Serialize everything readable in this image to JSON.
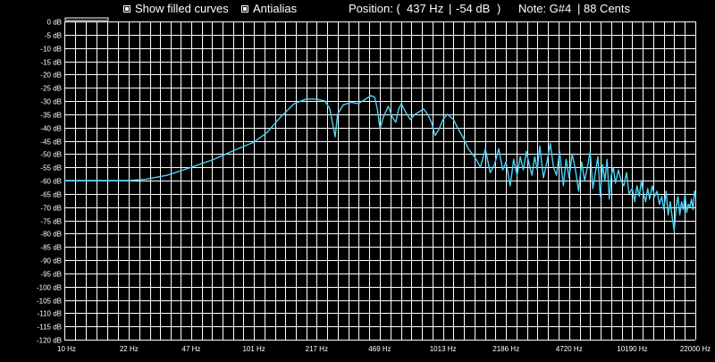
{
  "toolbar": {
    "show_filled_curves": {
      "label": "Show filled curves",
      "checked": true
    },
    "antialias": {
      "label": "Antialias",
      "checked": true
    },
    "position_label": "Position: (",
    "position_freq": "437 Hz",
    "position_sep": "|",
    "position_db": "-54 dB",
    "position_close": ")",
    "note_label": "Note: G#4",
    "cents_label": "| 88 Cents"
  },
  "colors": {
    "curve": "#4fd2f5",
    "grid": "#ffffff",
    "background": "#000000"
  },
  "chart_data": {
    "type": "line",
    "title": "",
    "xlabel": "",
    "ylabel": "",
    "x_scale": "log",
    "xlim": [
      10,
      22000
    ],
    "ylim": [
      -120,
      0
    ],
    "x_ticks": [
      10,
      22,
      47,
      101,
      217,
      469,
      1013,
      2186,
      4720,
      10190,
      22000
    ],
    "x_tick_labels": [
      "10 Hz",
      "22 Hz",
      "47 Hz",
      "101 Hz",
      "217 Hz",
      "469 Hz",
      "1013 Hz",
      "2186 Hz",
      "4720 Hz",
      "10190 Hz",
      "22000 Hz"
    ],
    "y_ticks": [
      0,
      -5,
      -10,
      -15,
      -20,
      -25,
      -30,
      -35,
      -40,
      -45,
      -50,
      -55,
      -60,
      -65,
      -70,
      -75,
      -80,
      -85,
      -90,
      -95,
      -100,
      -105,
      -110,
      -115,
      -120
    ],
    "y_tick_labels": [
      "0 dB",
      "-5 dB",
      "-10 dB",
      "-15 dB",
      "-20 dB",
      "-25 dB",
      "-30 dB",
      "-35 dB",
      "-40 dB",
      "-45 dB",
      "-50 dB",
      "-55 dB",
      "-60 dB",
      "-65 dB",
      "-70 dB",
      "-75 dB",
      "-80 dB",
      "-85 dB",
      "-90 dB",
      "-95 dB",
      "-100 dB",
      "-105 dB",
      "-110 dB",
      "-115 dB",
      "-120 dB"
    ],
    "grid": true,
    "series": [
      {
        "x": [
          10,
          15,
          22,
          27,
          35,
          47,
          62,
          80,
          101,
          118,
          140,
          165,
          190,
          217,
          240,
          255,
          266,
          272,
          280,
          300,
          330,
          360,
          390,
          420,
          440,
          455,
          470,
          490,
          520,
          545,
          570,
          590,
          610,
          640,
          680,
          720,
          760,
          800,
          840,
          880,
          920,
          960,
          1013,
          1070,
          1150,
          1230,
          1300,
          1380,
          1450,
          1520,
          1600,
          1700,
          1800,
          1900,
          2000,
          2100,
          2186,
          2300,
          2400,
          2500,
          2600,
          2700,
          2800,
          2900,
          3000,
          3100,
          3200,
          3300,
          3450,
          3600,
          3750,
          3900,
          4050,
          4200,
          4400,
          4550,
          4720,
          4900,
          5100,
          5300,
          5500,
          5700,
          5900,
          6100,
          6300,
          6500,
          6700,
          6900,
          7100,
          7300,
          7500,
          7700,
          7900,
          8100,
          8300,
          8600,
          8900,
          9200,
          9500,
          9800,
          10190,
          10500,
          10800,
          11100,
          11400,
          11700,
          12000,
          12300,
          12600,
          13000,
          13400,
          13800,
          14200,
          14600,
          15000,
          15400,
          15800,
          16200,
          16600,
          17000,
          17400,
          17800,
          18200,
          18600,
          19000,
          19400,
          19800,
          20200,
          20600,
          21000,
          21400,
          21800,
          22000
        ],
        "y": [
          -60,
          -60,
          -60,
          -59.5,
          -58,
          -55,
          -52,
          -48.5,
          -45.5,
          -42,
          -36,
          -31,
          -29.3,
          -29.3,
          -30,
          -33,
          -40,
          -43.5,
          -35,
          -31.5,
          -30.5,
          -31,
          -29.5,
          -28,
          -28.5,
          -33,
          -40.5,
          -36,
          -32,
          -36,
          -38,
          -33,
          -31,
          -34,
          -37,
          -35,
          -34,
          -33,
          -35,
          -38,
          -43,
          -41,
          -37,
          -35,
          -37,
          -41,
          -44,
          -48,
          -50,
          -52,
          -55,
          -48,
          -57,
          -54,
          -48,
          -56,
          -53,
          -62,
          -52,
          -58,
          -51,
          -56,
          -49,
          -54,
          -58,
          -51,
          -56,
          -47,
          -59,
          -53,
          -46,
          -55,
          -58,
          -49,
          -62,
          -52,
          -59,
          -50,
          -56,
          -64,
          -53,
          -60,
          -55,
          -49,
          -63,
          -57,
          -51,
          -66,
          -54,
          -60,
          -52,
          -67,
          -58,
          -55,
          -61,
          -56,
          -60,
          -62,
          -57,
          -65,
          -63,
          -68,
          -62,
          -66,
          -60,
          -65,
          -68,
          -63,
          -67,
          -62,
          -66,
          -64,
          -69,
          -66,
          -71,
          -64,
          -73,
          -68,
          -74,
          -79,
          -70,
          -66,
          -73,
          -68,
          -71,
          -65,
          -72,
          -69,
          -70,
          -67,
          -71,
          -64,
          -66
        ]
      }
    ]
  }
}
